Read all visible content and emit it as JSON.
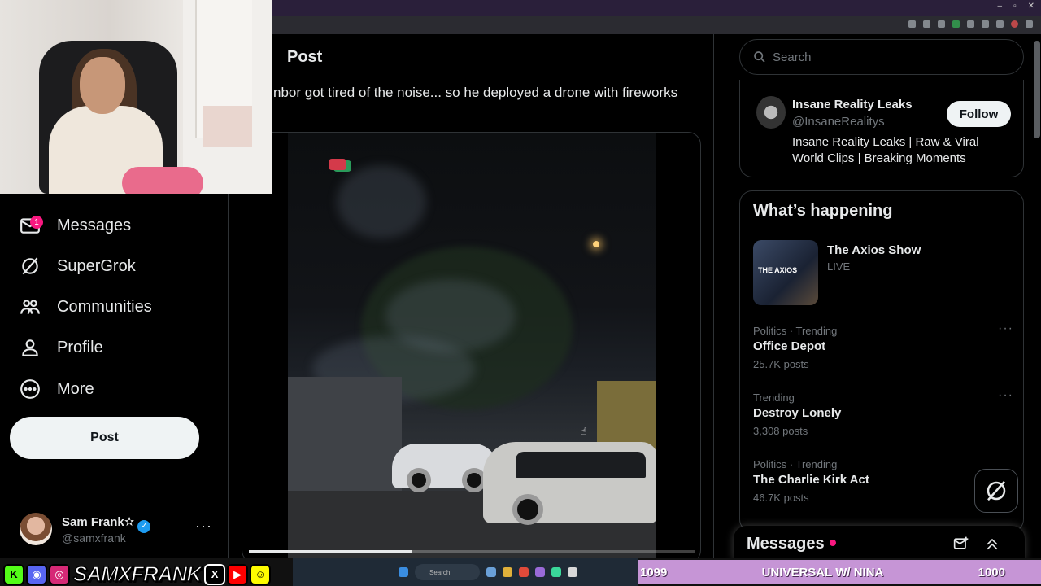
{
  "sidebar": {
    "items": [
      {
        "label": "Messages",
        "icon": "mail-icon",
        "badge": "1"
      },
      {
        "label": "SuperGrok",
        "icon": "grok-icon"
      },
      {
        "label": "Communities",
        "icon": "communities-icon"
      },
      {
        "label": "Profile",
        "icon": "profile-icon"
      },
      {
        "label": "More",
        "icon": "more-circle-icon"
      }
    ],
    "post_button": "Post",
    "account": {
      "name": "Sam Frank✫",
      "handle": "@samxfrank",
      "more": "···"
    }
  },
  "main": {
    "title": "Post",
    "text": "nbor got tired of the noise... so he deployed a drone with fireworks",
    "video_progress": 0.365
  },
  "search": {
    "placeholder": "Search"
  },
  "who_to_follow": {
    "name": "Insane Reality Leaks",
    "handle": "@InsaneRealitys",
    "bio": "Insane Reality Leaks | Raw & Viral World Clips | Breaking Moments",
    "follow_label": "Follow"
  },
  "trends": {
    "title": "What’s happening",
    "live": {
      "title": "The Axios Show",
      "status": "LIVE",
      "thumb_text": "THE AXIOS"
    },
    "items": [
      {
        "category": "Politics · Trending",
        "name": "Office Depot",
        "count": "25.7K posts"
      },
      {
        "category": "Trending",
        "name": "Destroy Lonely",
        "count": "3,308 posts"
      },
      {
        "category": "Politics · Trending",
        "name": "The Charlie Kirk Act",
        "count": "46.7K posts"
      }
    ],
    "more": "···"
  },
  "messages_drawer": {
    "title": "Messages"
  },
  "overlay": {
    "brand": "SAMXFRANK",
    "left_count": "1099",
    "banner_text": "UNIVERSAL W/ NINA",
    "right_count": "1000",
    "taskbar_search": "Search"
  },
  "colors": {
    "accent": "#1d9bf0",
    "badge": "#f91880",
    "banner": "#c695d6"
  }
}
